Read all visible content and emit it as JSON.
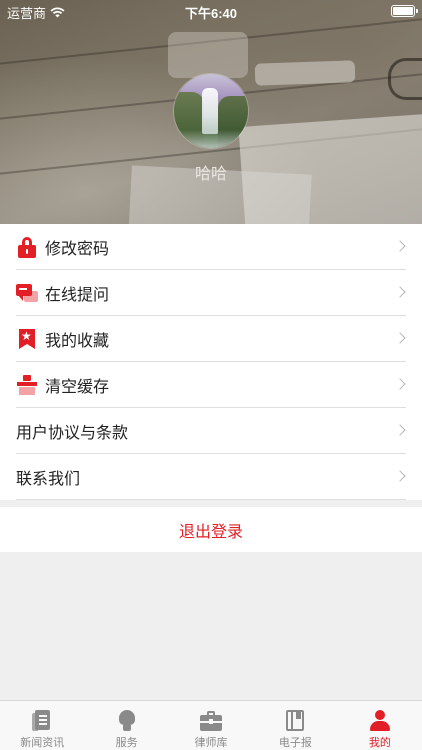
{
  "status_bar": {
    "carrier": "运营商",
    "time": "下午6:40"
  },
  "profile": {
    "username": "哈哈",
    "avatar_icon": "waterfall-avatar"
  },
  "menu": {
    "items": [
      {
        "label": "修改密码",
        "icon": "lock-icon"
      },
      {
        "label": "在线提问",
        "icon": "chat-icon"
      },
      {
        "label": "我的收藏",
        "icon": "bookmark-star-icon"
      },
      {
        "label": "清空缓存",
        "icon": "clear-cache-icon"
      },
      {
        "label": "用户协议与条款",
        "icon": ""
      },
      {
        "label": "联系我们",
        "icon": ""
      }
    ]
  },
  "logout": {
    "label": "退出登录"
  },
  "tabbar": {
    "tabs": [
      {
        "label": "新闻资讯",
        "icon": "news-icon",
        "active": false
      },
      {
        "label": "服务",
        "icon": "lightbulb-icon",
        "active": false
      },
      {
        "label": "律师库",
        "icon": "briefcase-icon",
        "active": false
      },
      {
        "label": "电子报",
        "icon": "book-icon",
        "active": false
      },
      {
        "label": "我的",
        "icon": "person-icon",
        "active": true
      }
    ]
  },
  "colors": {
    "accent": "#e21f26",
    "tab_inactive": "#8a8a8a",
    "background": "#efefef"
  }
}
